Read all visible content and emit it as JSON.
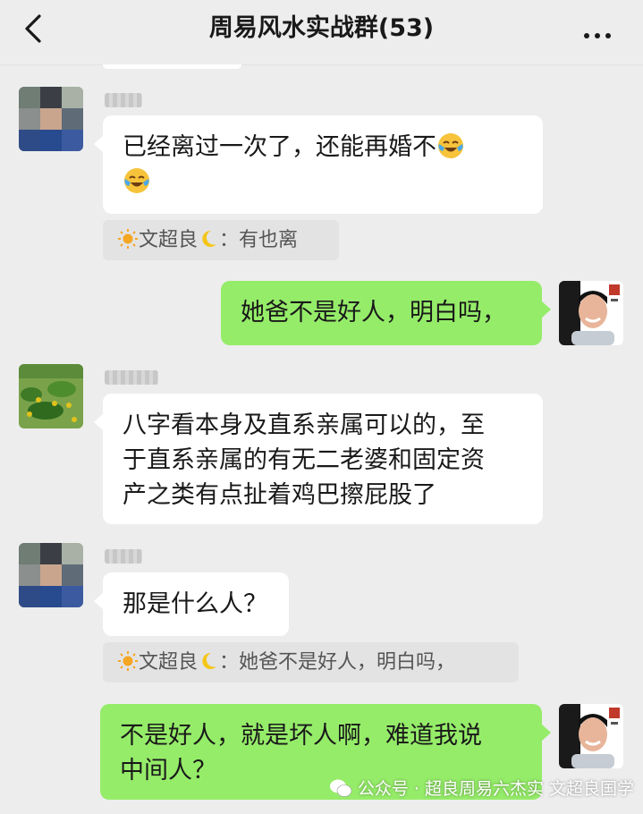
{
  "header": {
    "title": "周易风水实战群(53)"
  },
  "messages": [
    {
      "text": "已经离过一次了，还能再婚不"
    },
    {
      "quote_sender": "文超良",
      "quote_sep": "：",
      "quote_text": "有也离"
    },
    {
      "text": "她爸不是好人，明白吗，"
    },
    {
      "lines": [
        "八字看本身及直系亲属可以的，至",
        "于直系亲属的有无二老婆和固定资",
        "产之类有点扯着鸡巴擦屁股了"
      ]
    },
    {
      "text": "那是什么人？"
    },
    {
      "quote_sender": "文超良",
      "quote_sep": "：",
      "quote_text": "她爸不是好人，明白吗，"
    },
    {
      "lines": [
        "不是好人，就是坏人啊，难道我说",
        "中间人？"
      ]
    }
  ],
  "watermark": {
    "text": "公众号 · 超良周易六杰实",
    "overlay": "文超良国学"
  },
  "colors": {
    "background": "#ededed",
    "self_bubble": "#95ec69",
    "other_bubble": "#ffffff",
    "quote_bg": "#e3e3e3"
  },
  "icons": [
    "back-icon",
    "more-icon",
    "crying-laughing-emoji",
    "sun-icon",
    "moon-icon",
    "wechat-icon"
  ]
}
